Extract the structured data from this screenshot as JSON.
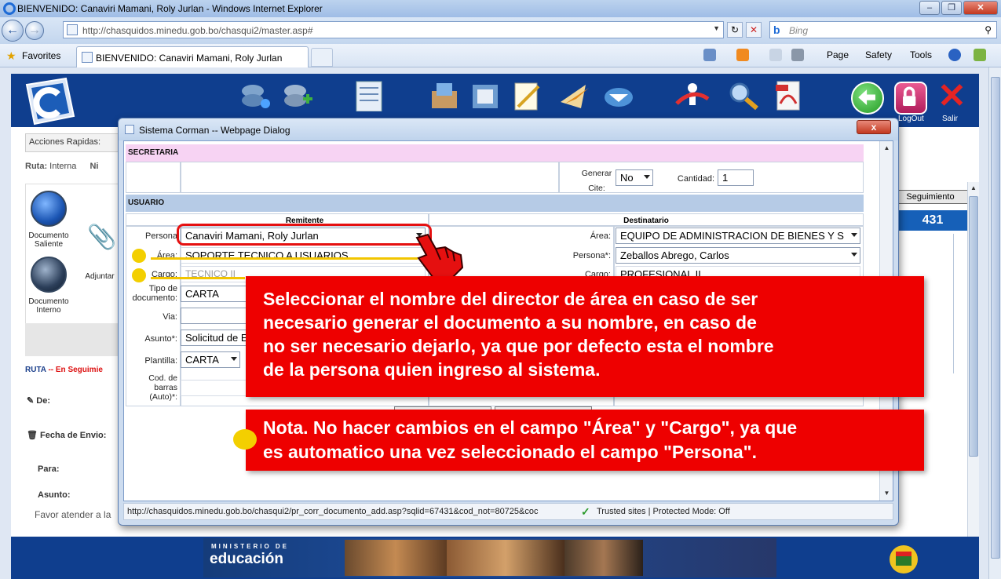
{
  "browser": {
    "window_title": "BIENVENIDO: Canaviri Mamani, Roly Jurlan - Windows Internet Explorer",
    "url": "http://chasquidos.minedu.gob.bo/chasqui2/master.asp#",
    "search_placeholder": "Bing",
    "favorites_label": "Favorites",
    "tab_title": "BIENVENIDO: Canaviri Mamani, Roly Jurlan",
    "commands": {
      "page": "Page",
      "safety": "Safety",
      "tools": "Tools"
    }
  },
  "app": {
    "toolbar": {
      "logout": "LogOut",
      "salir": "Salir"
    },
    "quick_actions": "Acciones Rapidas:",
    "ruta_label": "Ruta:",
    "ruta_value": "Interna",
    "ruta_ni": "Ni",
    "side_items": [
      {
        "label": "Documento Saliente"
      },
      {
        "label": "Adjuntar"
      },
      {
        "label": "Documento Interno"
      }
    ],
    "ruta_seguimiento": {
      "prefix": "RUTA",
      "suffix": "-- En Seguimie"
    },
    "de_label": "De:",
    "fecha_label": "Fecha de Envio:",
    "para_label": "Para:",
    "asunto_label": "Asunto:",
    "favor_text": "Favor atender a la",
    "seguimiento_button": "Seguimiento",
    "doc_number": "431",
    "footer": {
      "ministerio": "MINISTERIO DE",
      "educacion": "educación"
    }
  },
  "dialog": {
    "title": "Sistema Corman -- Webpage Dialog",
    "close": "x",
    "sections": {
      "secretaria": "SECRETARIA",
      "usuario": "USUARIO"
    },
    "generar_cite_label": "Generar Cite:",
    "generar_cite_value": "No",
    "cantidad_label": "Cantidad:",
    "cantidad_value": "1",
    "remitente_header": "Remitente",
    "destinatario_header": "Destinatario",
    "remitente": {
      "persona_label": "Persona",
      "persona_value": "Canaviri Mamani, Roly Jurlan",
      "area_label": "Área:",
      "area_value": "SOPORTE TECNICO A USUARIOS",
      "cargo_label": "Cargo:",
      "cargo_value": "TECNICO II",
      "tipo_label": "Tipo de documento:",
      "tipo_value": "CARTA",
      "via_label": "Via:",
      "asunto_label": "Asunto*:",
      "asunto_value": "Solicitud de E",
      "plantilla_label": "Plantilla:",
      "plantilla_value": "CARTA",
      "codbarras_label": "Cod. de barras (Auto)*:"
    },
    "destinatario": {
      "area_label": "Área:",
      "area_value": "EQUIPO DE ADMINISTRACION DE BIENES Y S",
      "persona_label": "Persona*:",
      "persona_value": "Zeballos Abrego, Carlos",
      "cargo_label": "Cargo:",
      "cargo_value": "PROFESIONAL II"
    },
    "status_url": "http://chasquidos.minedu.gob.bo/chasqui2/pr_corr_documento_add.asp?sqlid=67431&cod_not=80725&coc",
    "status_zone": "Trusted sites | Protected Mode: Off"
  },
  "callouts": {
    "main": [
      "Seleccionar el nombre del director de área en caso de ser",
      "necesario generar el documento a su nombre, en caso de",
      "no ser necesario dejarlo, ya que por defecto esta el nombre",
      "de la persona quien ingreso al sistema."
    ],
    "note": [
      "Nota. No hacer cambios en el campo \"Área\" y \"Cargo\", ya que",
      "es automatico una vez seleccionado el campo \"Persona\"."
    ]
  },
  "colors": {
    "callout": "#ee0000",
    "highlight": "#f3cf00",
    "app_blue": "#0f3e8e"
  }
}
